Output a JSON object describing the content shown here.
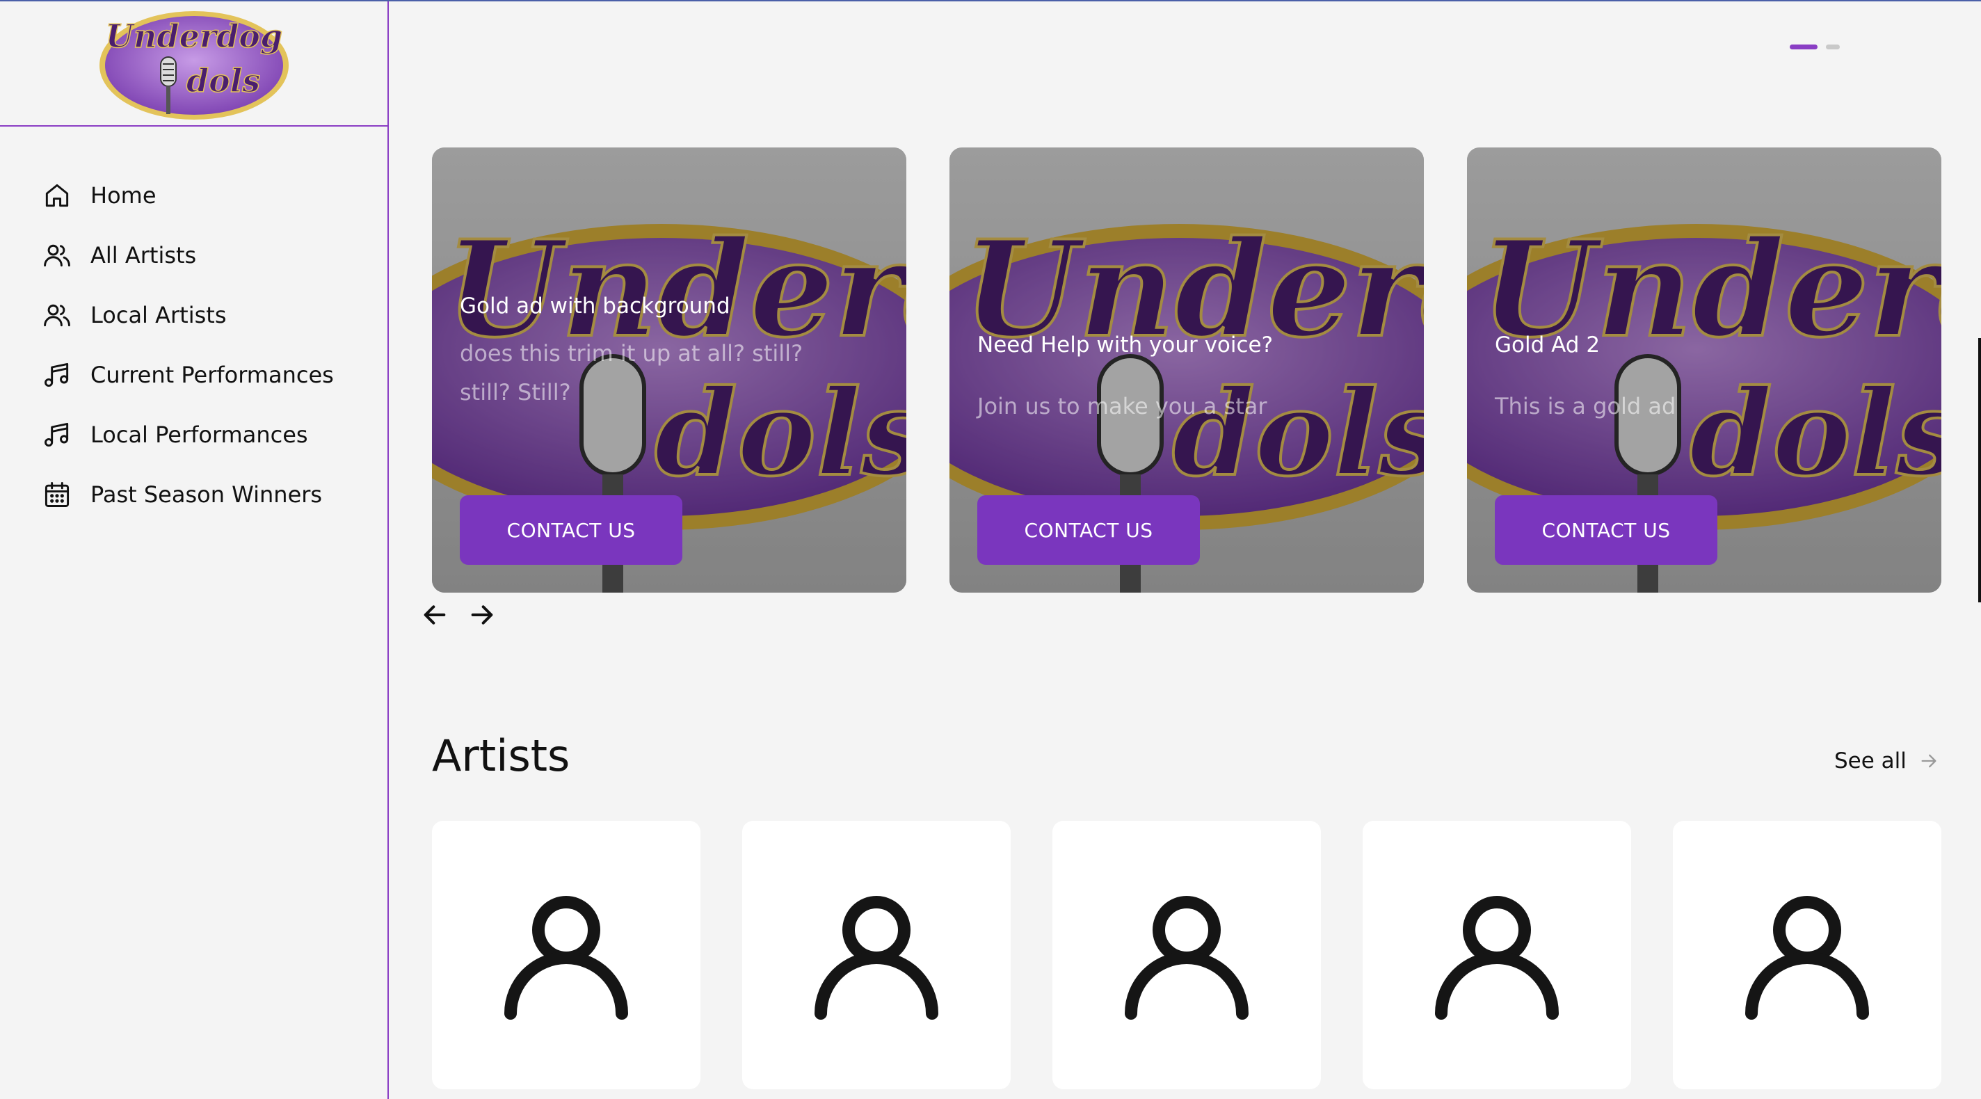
{
  "brand": {
    "logo_line1": "Underdog",
    "logo_line2": "dols"
  },
  "sidebar": {
    "items": [
      {
        "label": "Home",
        "icon": "home-icon"
      },
      {
        "label": "All Artists",
        "icon": "users-icon"
      },
      {
        "label": "Local Artists",
        "icon": "users-icon"
      },
      {
        "label": "Current Performances",
        "icon": "music-note-icon"
      },
      {
        "label": "Local Performances",
        "icon": "music-note-icon"
      },
      {
        "label": "Past Season Winners",
        "icon": "calendar-icon"
      }
    ]
  },
  "carousel": {
    "page_count": 2,
    "active_page": 1,
    "ads": [
      {
        "title": "Gold ad with background",
        "description": "does this trim it up at all? still? still? Still?",
        "button": "CONTACT US"
      },
      {
        "title": "Need Help with your voice?",
        "description": "Join us to make you a star",
        "button": "CONTACT US"
      },
      {
        "title": "Gold Ad 2",
        "description": "This is a gold ad",
        "button": "CONTACT US"
      }
    ]
  },
  "artists_section": {
    "title": "Artists",
    "see_all": "See all",
    "card_count": 5
  },
  "colors": {
    "accent": "#7a36be",
    "border": "#8a3ec4",
    "logo_gold": "#d9b13b",
    "logo_purple": "#9a5fc8"
  }
}
